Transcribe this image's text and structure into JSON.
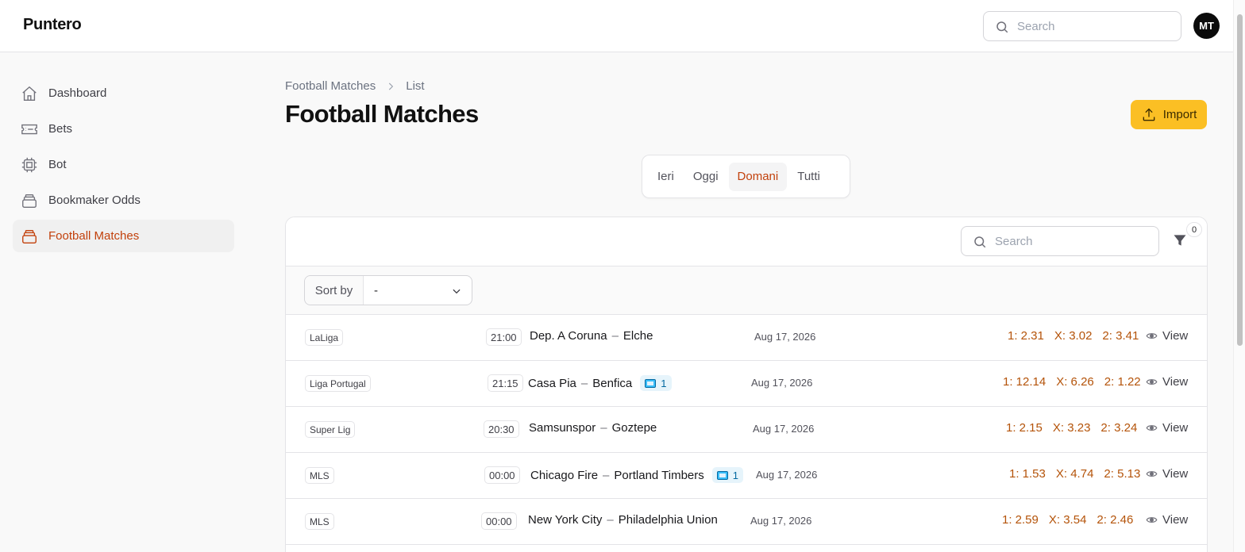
{
  "app": {
    "brand": "Puntero"
  },
  "topbar": {
    "search_placeholder": "Search",
    "avatar_initials": "MT"
  },
  "sidebar": {
    "items": [
      {
        "label": "Dashboard",
        "icon": "home-icon"
      },
      {
        "label": "Bets",
        "icon": "ticket-icon"
      },
      {
        "label": "Bot",
        "icon": "cpu-icon"
      },
      {
        "label": "Bookmaker Odds",
        "icon": "stack-icon"
      },
      {
        "label": "Football Matches",
        "icon": "stack-icon",
        "active": true
      }
    ]
  },
  "breadcrumb": {
    "parent": "Football Matches",
    "current": "List"
  },
  "page": {
    "title": "Football Matches",
    "import_label": "Import"
  },
  "tabs": [
    {
      "label": "Ieri"
    },
    {
      "label": "Oggi"
    },
    {
      "label": "Domani",
      "active": true
    },
    {
      "label": "Tutti"
    }
  ],
  "table": {
    "search_placeholder": "Search",
    "filter_count": "0",
    "sort_label": "Sort by",
    "sort_value": "-",
    "view_label": "View",
    "rows": [
      {
        "league": "LaLiga",
        "time": "21:00",
        "home": "Dep. A Coruna",
        "away": "Elche",
        "tv": null,
        "date": "Aug 17, 2026",
        "odds": [
          "1: 2.31",
          "X: 3.02",
          "2: 3.41"
        ]
      },
      {
        "league": "Liga Portugal",
        "time": "21:15",
        "home": "Casa Pia",
        "away": "Benfica",
        "tv": "1",
        "date": "Aug 17, 2026",
        "odds": [
          "1: 12.14",
          "X: 6.26",
          "2: 1.22"
        ]
      },
      {
        "league": "Super Lig",
        "time": "20:30",
        "home": "Samsunspor",
        "away": "Goztepe",
        "tv": null,
        "date": "Aug 17, 2026",
        "odds": [
          "1: 2.15",
          "X: 3.23",
          "2: 3.24"
        ]
      },
      {
        "league": "MLS",
        "time": "00:00",
        "home": "Chicago Fire",
        "away": "Portland Timbers",
        "tv": "1",
        "date": "Aug 17, 2026",
        "odds": [
          "1: 1.53",
          "X: 4.74",
          "2: 5.13"
        ]
      },
      {
        "league": "MLS",
        "time": "00:00",
        "home": "New York City",
        "away": "Philadelphia Union",
        "tv": null,
        "date": "Aug 17, 2026",
        "odds": [
          "1: 2.59",
          "X: 3.54",
          "2: 2.46"
        ]
      }
    ]
  },
  "colors": {
    "accent": "#c2410c",
    "button": "#fbbf24",
    "odds": "#b45309"
  }
}
